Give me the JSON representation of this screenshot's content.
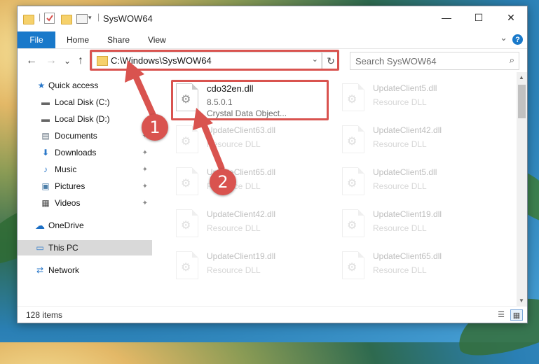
{
  "window": {
    "title": "SysWOW64",
    "controls": {
      "minimize": "—",
      "maximize": "☐",
      "close": "✕"
    }
  },
  "quick_access_toolbar": {
    "folder_icon": "folder-icon",
    "properties_icon": "properties-check-icon",
    "new_folder_icon": "new-folder-icon",
    "customize_icon": "customize-dropdown-icon",
    "separator": "|"
  },
  "ribbon": {
    "tabs": [
      "File",
      "Home",
      "Share",
      "View"
    ],
    "expand_glyph": "⌄",
    "help_glyph": "?"
  },
  "navigation": {
    "back_glyph": "←",
    "forward_glyph": "→",
    "recent_glyph": "⌄",
    "up_glyph": "↑"
  },
  "address_bar": {
    "path": "C:\\Windows\\SysWOW64",
    "dropdown_glyph": "⌄",
    "refresh_glyph": "↻"
  },
  "search": {
    "placeholder": "Search SysWOW64",
    "icon_glyph": "⌕"
  },
  "sidebar": {
    "items": [
      {
        "label": "Quick access",
        "icon": "star-icon",
        "glyph": "★",
        "pinned": false
      },
      {
        "label": "Local Disk (C:)",
        "icon": "drive-icon",
        "glyph": "▬",
        "pinned": false
      },
      {
        "label": "Local Disk (D:)",
        "icon": "drive-icon",
        "glyph": "▬",
        "pinned": false
      },
      {
        "label": "Documents",
        "icon": "documents-icon",
        "glyph": "▤",
        "pinned": true
      },
      {
        "label": "Downloads",
        "icon": "download-icon",
        "glyph": "⬇",
        "pinned": true
      },
      {
        "label": "Music",
        "icon": "music-icon",
        "glyph": "♪",
        "pinned": true
      },
      {
        "label": "Pictures",
        "icon": "pictures-icon",
        "glyph": "▣",
        "pinned": true
      },
      {
        "label": "Videos",
        "icon": "video-icon",
        "glyph": "▦",
        "pinned": true
      },
      {
        "label": "OneDrive",
        "icon": "cloud-icon",
        "glyph": "☁",
        "pinned": false
      },
      {
        "label": "This PC",
        "icon": "computer-icon",
        "glyph": "▭",
        "pinned": false
      },
      {
        "label": "Network",
        "icon": "network-icon",
        "glyph": "⇄",
        "pinned": false
      }
    ],
    "pin_glyph": "📌"
  },
  "files": [
    {
      "name": "cdo32en.dll",
      "line2": "8.5.0.1",
      "line3": "Crystal Data Object...",
      "highlighted": true
    },
    {
      "name": "UpdateClient5.dll",
      "line2": "Resource DLL",
      "line3": ""
    },
    {
      "name": "UpdateClient63.dll",
      "line2": "Resource DLL",
      "line3": ""
    },
    {
      "name": "UpdateClient42.dll",
      "line2": "Resource DLL",
      "line3": ""
    },
    {
      "name": "UpdateClient65.dll",
      "line2": "Resource DLL",
      "line3": ""
    },
    {
      "name": "UpdateClient5.dll",
      "line2": "Resource DLL",
      "line3": ""
    },
    {
      "name": "UpdateClient42.dll",
      "line2": "Resource DLL",
      "line3": ""
    },
    {
      "name": "UpdateClient19.dll",
      "line2": "Resource DLL",
      "line3": ""
    },
    {
      "name": "UpdateClient19.dll",
      "line2": "Resource DLL",
      "line3": ""
    },
    {
      "name": "UpdateClient65.dll",
      "line2": "Resource DLL",
      "line3": ""
    }
  ],
  "status": {
    "item_count": "128 items",
    "details_view_glyph": "☰",
    "tiles_view_glyph": "▦"
  },
  "annotations": {
    "markers": [
      "1",
      "2"
    ],
    "color": "#d9534f"
  },
  "colors": {
    "accent": "#1979ca",
    "highlight": "#d9534f",
    "selected_nav": "#d9d9d9"
  }
}
